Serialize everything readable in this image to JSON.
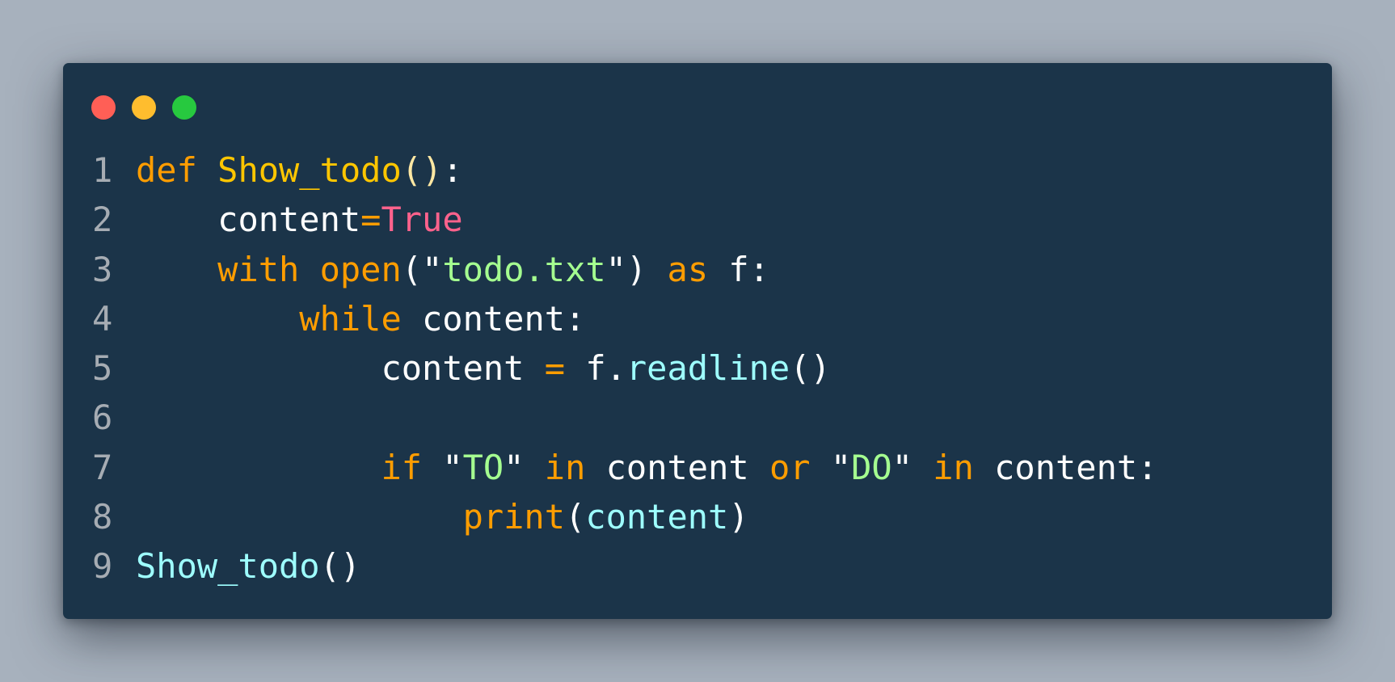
{
  "window": {
    "traffic_lights": [
      {
        "name": "close",
        "color": "#ff5f56"
      },
      {
        "name": "minimize",
        "color": "#ffbd2e"
      },
      {
        "name": "maximize",
        "color": "#27c93f"
      }
    ]
  },
  "code": {
    "language": "python",
    "line_numbers": [
      "1",
      "2",
      "3",
      "4",
      "5",
      "6",
      "7",
      "8",
      "9"
    ],
    "lines": [
      {
        "indent": "",
        "tokens": [
          {
            "t": "def",
            "k": "keyword"
          },
          {
            "t": " ",
            "k": "ident"
          },
          {
            "t": "Show_todo",
            "k": "fn-def"
          },
          {
            "t": "()",
            "k": "paren"
          },
          {
            "t": ":",
            "k": "punct"
          }
        ]
      },
      {
        "indent": "    ",
        "tokens": [
          {
            "t": "content",
            "k": "ident"
          },
          {
            "t": "=",
            "k": "op"
          },
          {
            "t": "True",
            "k": "const"
          }
        ]
      },
      {
        "indent": "    ",
        "tokens": [
          {
            "t": "with",
            "k": "keyword"
          },
          {
            "t": " ",
            "k": "ident"
          },
          {
            "t": "open",
            "k": "builtin"
          },
          {
            "t": "(",
            "k": "paren-w"
          },
          {
            "t": "\"",
            "k": "quote"
          },
          {
            "t": "todo.txt",
            "k": "string"
          },
          {
            "t": "\"",
            "k": "quote"
          },
          {
            "t": ")",
            "k": "paren-w"
          },
          {
            "t": " ",
            "k": "ident"
          },
          {
            "t": "as",
            "k": "keyword"
          },
          {
            "t": " f:",
            "k": "ident"
          }
        ]
      },
      {
        "indent": "        ",
        "tokens": [
          {
            "t": "while",
            "k": "keyword"
          },
          {
            "t": " content:",
            "k": "ident"
          }
        ]
      },
      {
        "indent": "            ",
        "tokens": [
          {
            "t": "content ",
            "k": "ident"
          },
          {
            "t": "=",
            "k": "op"
          },
          {
            "t": " f.",
            "k": "ident"
          },
          {
            "t": "readline",
            "k": "call"
          },
          {
            "t": "()",
            "k": "paren-w"
          }
        ]
      },
      {
        "indent": "",
        "tokens": []
      },
      {
        "indent": "            ",
        "tokens": [
          {
            "t": "if",
            "k": "keyword"
          },
          {
            "t": " ",
            "k": "ident"
          },
          {
            "t": "\"",
            "k": "quote"
          },
          {
            "t": "TO",
            "k": "string"
          },
          {
            "t": "\"",
            "k": "quote"
          },
          {
            "t": " ",
            "k": "ident"
          },
          {
            "t": "in",
            "k": "keyword"
          },
          {
            "t": " content ",
            "k": "ident"
          },
          {
            "t": "or",
            "k": "keyword"
          },
          {
            "t": " ",
            "k": "ident"
          },
          {
            "t": "\"",
            "k": "quote"
          },
          {
            "t": "DO",
            "k": "string"
          },
          {
            "t": "\"",
            "k": "quote"
          },
          {
            "t": " ",
            "k": "ident"
          },
          {
            "t": "in",
            "k": "keyword"
          },
          {
            "t": " content:",
            "k": "ident"
          }
        ]
      },
      {
        "indent": "                ",
        "tokens": [
          {
            "t": "print",
            "k": "builtin"
          },
          {
            "t": "(",
            "k": "paren-w"
          },
          {
            "t": "content",
            "k": "call"
          },
          {
            "t": ")",
            "k": "paren-w"
          }
        ]
      },
      {
        "indent": "",
        "tokens": [
          {
            "t": "Show_todo",
            "k": "call"
          },
          {
            "t": "()",
            "k": "paren-w"
          }
        ]
      }
    ]
  }
}
